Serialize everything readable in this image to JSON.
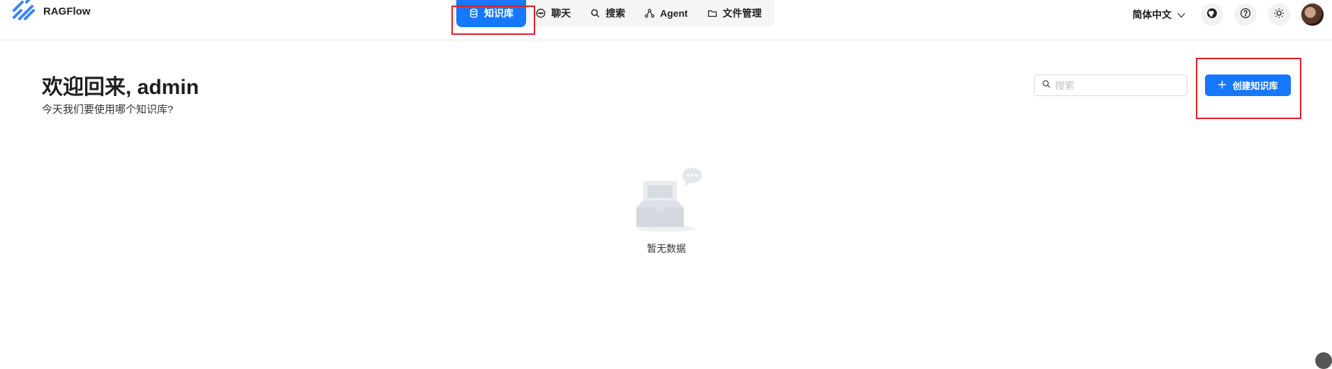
{
  "brand": {
    "name": "RAGFlow"
  },
  "nav": {
    "items": [
      {
        "label": "知识库",
        "icon": "database-icon",
        "active": true
      },
      {
        "label": "聊天",
        "icon": "chat-icon",
        "active": false
      },
      {
        "label": "搜索",
        "icon": "search-icon",
        "active": false
      },
      {
        "label": "Agent",
        "icon": "agent-graph-icon",
        "active": false
      },
      {
        "label": "文件管理",
        "icon": "folder-icon",
        "active": false
      }
    ]
  },
  "header": {
    "language": "简体中文"
  },
  "main": {
    "welcome_title": "欢迎回来, admin",
    "welcome_subtitle": "今天我们要使用哪个知识库?",
    "search_placeholder": "搜索",
    "create_label": "创建知识库",
    "empty_text": "暂无数据"
  },
  "colors": {
    "accent": "#1677ff",
    "highlight": "#e01b24"
  }
}
